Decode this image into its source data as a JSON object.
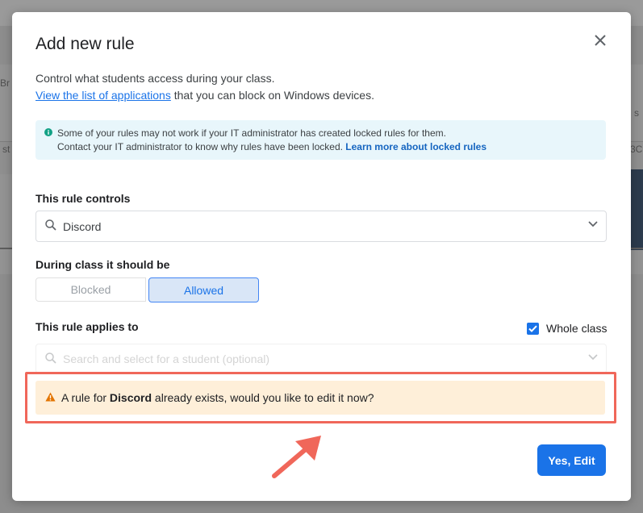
{
  "background": {
    "left_text": "Br",
    "left_text2": "st",
    "right_text": "3C",
    "right_text2": "s"
  },
  "modal": {
    "title": "Add new rule",
    "description_line1": "Control what students access during your class.",
    "description_link": "View the list of applications",
    "description_line2_rest": " that you can block on Windows devices.",
    "info": {
      "line1": "Some of your rules may not work if your IT administrator has created locked rules for them.",
      "line2": "Contact your IT administrator to know why rules have been locked. ",
      "link": "Learn more about locked rules"
    },
    "rule_controls_label": "This rule controls",
    "rule_controls_value": "Discord",
    "during_class_label": "During class it should be",
    "toggle": {
      "blocked": "Blocked",
      "allowed": "Allowed",
      "selected": "Allowed"
    },
    "applies_to_label": "This rule applies to",
    "whole_class_label": "Whole class",
    "whole_class_checked": true,
    "student_placeholder": "Search and select for a student (optional)",
    "warning": {
      "prefix": "A rule for ",
      "app": "Discord",
      "suffix": " already exists, would you like to edit it now?"
    },
    "primary_button": "Yes, Edit"
  },
  "colors": {
    "primary": "#1a73e8",
    "highlight": "#f0675a",
    "warning_bg": "#feefd9",
    "info_bg": "#e8f6fb",
    "warning_icon": "#e37400",
    "info_icon": "#12a185"
  },
  "icons": {
    "close": "close-icon",
    "info": "info-icon",
    "search": "search-icon",
    "chevron": "chevron-down-icon",
    "check": "check-icon",
    "warning": "warning-icon",
    "arrow": "annotation-arrow-icon"
  }
}
